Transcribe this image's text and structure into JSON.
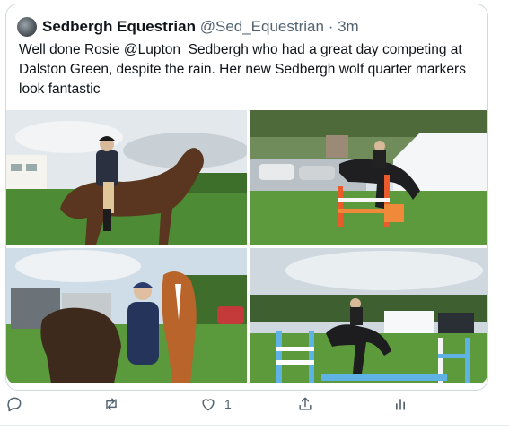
{
  "tweet": {
    "display_name": "Sedbergh Equestrian",
    "handle": "@Sed_Equestrian",
    "separator": "·",
    "time": "3m",
    "text": "Well done Rosie @Lupton_Sedbergh who had a great day competing at Dalston Green, despite the rain. Her new Sedbergh wolf quarter markers look fantastic"
  },
  "actions": {
    "reply_icon": "reply-icon",
    "retweet_icon": "retweet-icon",
    "like_icon": "heart-icon",
    "like_count": "1",
    "share_icon": "share-icon",
    "analytics_icon": "analytics-icon"
  },
  "colors": {
    "text": "#0f1419",
    "secondary": "#536471",
    "border": "#cfd9de",
    "grass": "#4f8f38",
    "sky": "#dfe8ee"
  }
}
